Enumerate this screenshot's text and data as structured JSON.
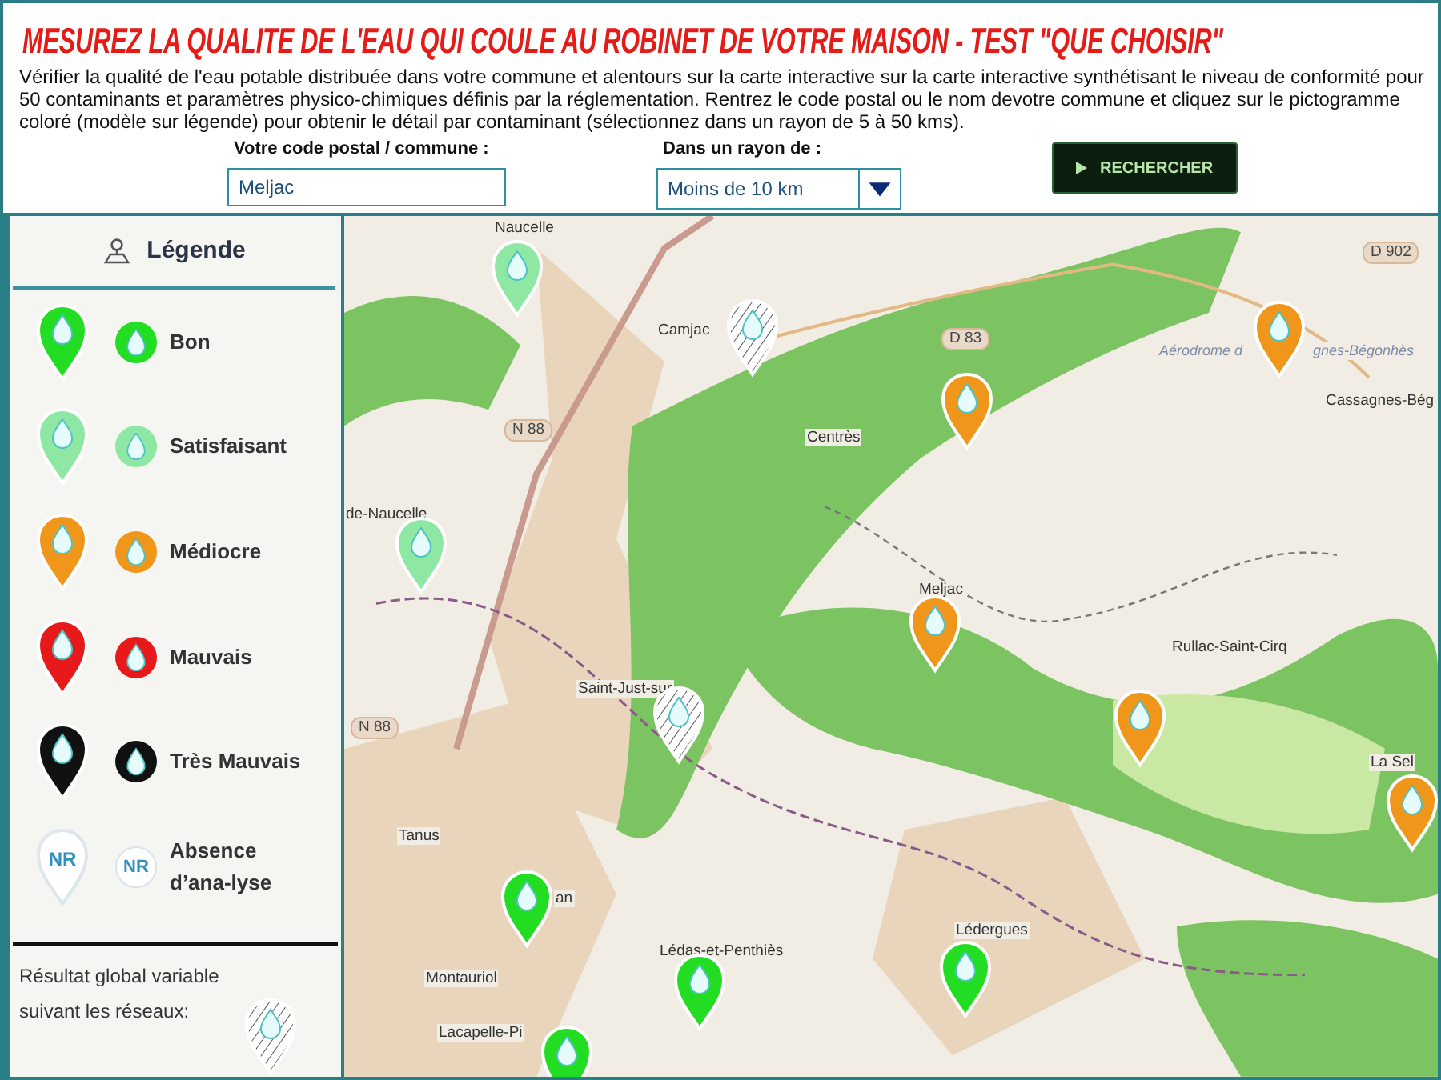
{
  "header": {
    "title": "MESUREZ LA QUALITE DE L'EAU QUI COULE AU ROBINET DE VOTRE MAISON - TEST \"QUE CHOISIR\"",
    "description": "Vérifier la qualité de l'eau potable distribuée dans votre commune et alentours sur la carte interactive sur la carte interactive synthétisant le niveau de conformité pour 50 contaminants et paramètres physico-chimiques définis par la réglementation. Rentrez le code postal ou le nom devotre commune et cliquez sur le pictogramme coloré (modèle sur légende) pour obtenir le détail par contaminant (sélectionnez dans un rayon de 5 à 50 kms)."
  },
  "search": {
    "postal_label": "Votre code postal / commune :",
    "postal_value": "Meljac",
    "radius_label": "Dans un rayon de :",
    "radius_value": "Moins de 10 km",
    "button": "RECHERCHER"
  },
  "legend": {
    "title": "Légende",
    "items": [
      {
        "label": "Bon",
        "kind": "drop",
        "color": "#22dd22"
      },
      {
        "label": "Satisfaisant",
        "kind": "drop",
        "color": "#8ee8a4"
      },
      {
        "label": "Médiocre",
        "kind": "drop",
        "color": "#f0961a"
      },
      {
        "label": "Mauvais",
        "kind": "drop",
        "color": "#e8191b"
      },
      {
        "label": "Très Mauvais",
        "kind": "drop",
        "color": "#111111"
      },
      {
        "label": "Absence d’ana-lyse",
        "kind": "nr",
        "color": "#ffffff",
        "pin_text": "NR",
        "icon_text": "NR"
      }
    ],
    "note": "Résultat global variable suivant les réseaux:"
  },
  "map": {
    "places": [
      "Naucelle",
      "Camjac",
      "Centrès",
      "Meljac",
      "Cassagnes-Bég",
      "de-Naucelle",
      "Saint-Just-sur",
      "Rullac-Saint-Cirq",
      "Tanus",
      "an",
      "Montauriol",
      "Lédas-et-Penthiès",
      "Lédergues",
      "Lacapelle-Pi",
      "La Sel",
      "Aérodrome d",
      "gnes-Bégonhès"
    ],
    "roads": [
      "N 88",
      "N 88",
      "D 83",
      "D 902"
    ],
    "markers": [
      {
        "kind": "drop",
        "color": "#8ee8a4"
      },
      {
        "kind": "striped",
        "color": "#ffffff"
      },
      {
        "kind": "drop",
        "color": "#f0961a"
      },
      {
        "kind": "drop",
        "color": "#f0961a"
      },
      {
        "kind": "drop",
        "color": "#8ee8a4"
      },
      {
        "kind": "drop",
        "color": "#f0961a"
      },
      {
        "kind": "striped",
        "color": "#ffffff"
      },
      {
        "kind": "drop",
        "color": "#f0961a"
      },
      {
        "kind": "drop",
        "color": "#f0961a"
      },
      {
        "kind": "drop",
        "color": "#22dd22"
      },
      {
        "kind": "drop",
        "color": "#22dd22"
      },
      {
        "kind": "drop",
        "color": "#22dd22"
      },
      {
        "kind": "drop",
        "color": "#22dd22"
      }
    ]
  }
}
